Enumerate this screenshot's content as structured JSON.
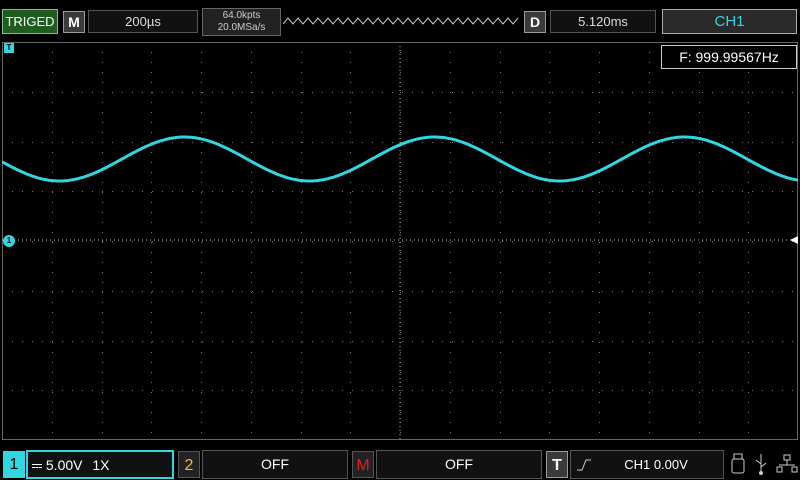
{
  "top": {
    "trig_status": "TRIGED",
    "mode_letter": "M",
    "timebase": "200µs",
    "mem_depth": "64.0kpts",
    "sample_rate": "20.0MSa/s",
    "delay_letter": "D",
    "delay": "5.120ms",
    "channel": "CH1"
  },
  "screen": {
    "frequency": "F: 999.99567Hz",
    "trigger_marker": "T",
    "ch1_marker": "1"
  },
  "bottom": {
    "ch1_num": "1",
    "ch1_scale": "5.00V",
    "ch1_probe": "1X",
    "ch2_num": "2",
    "ch2_state": "OFF",
    "math_letter": "M",
    "math_state": "OFF",
    "trig_letter": "T",
    "trig_info": "CH1 0.00V"
  },
  "colors": {
    "ch1": "#31d6e0",
    "ch2": "#e8c32a",
    "math": "#e02020",
    "grid": "#777777"
  }
}
